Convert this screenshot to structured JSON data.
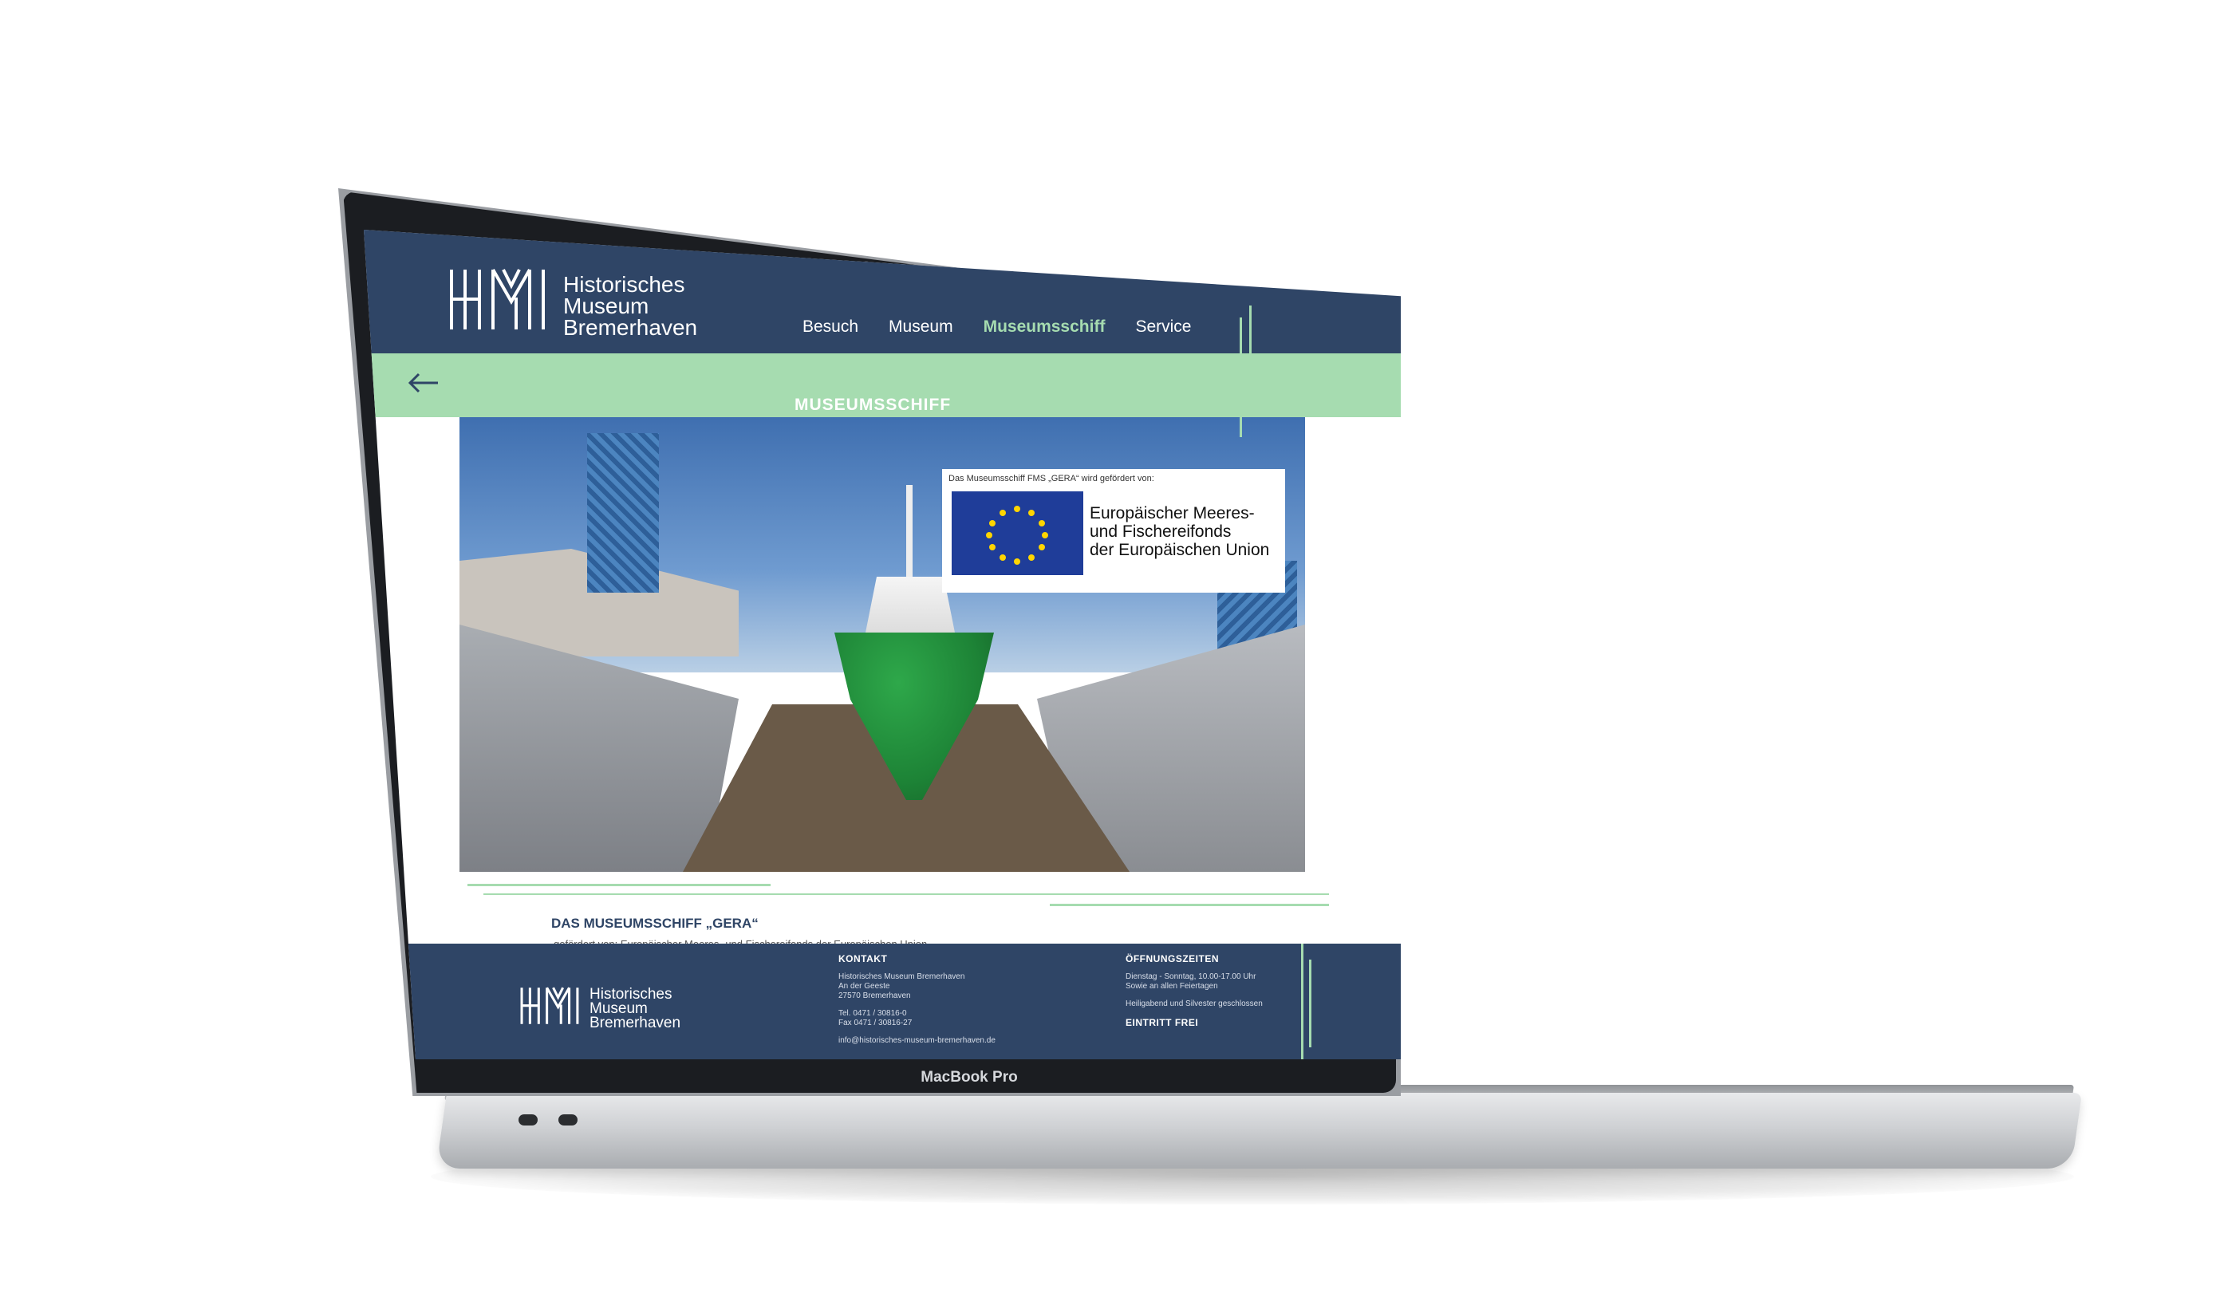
{
  "site": {
    "logo_lines": [
      "Historisches",
      "Museum",
      "Bremerhaven"
    ]
  },
  "nav": {
    "items": [
      "Besuch",
      "Museum",
      "Museumsschiff",
      "Service"
    ],
    "active": "Museumsschiff"
  },
  "page": {
    "heading": "MUSEUMSSCHIFF"
  },
  "hero": {
    "eu_caption": "Das Museumsschiff FMS „GERA“ wird gefördert von:",
    "eu_lines": [
      "Europäischer Meeres-",
      "und Fischereifonds",
      "der Europäischen Union"
    ]
  },
  "article": {
    "title": "DAS MUSEUMSSCHIFF „GERA“",
    "subtitle": "gefördert von: Europäischer Meeres- und Fischereifonds der Europäischen Union"
  },
  "footer": {
    "logo_lines": [
      "Historisches",
      "Museum",
      "Bremerhaven"
    ],
    "kontakt": {
      "heading": "KONTAKT",
      "address": [
        "Historisches Museum Bremerhaven",
        "An der Geeste",
        "27570 Bremerhaven"
      ],
      "tel": "Tel. 0471 / 30816-0",
      "fax": "Fax 0471 / 30816-27",
      "email": "info@historisches-museum-bremerhaven.de"
    },
    "hours": {
      "heading": "ÖFFNUNGSZEITEN",
      "lines": [
        "Dienstag - Sonntag, 10.00-17.00 Uhr",
        "Sowie an allen Feiertagen"
      ],
      "closed": "Heiligabend und Silvester geschlossen",
      "free": "EINTRITT FREI"
    }
  },
  "device": {
    "label": "MacBook Pro"
  },
  "colors": {
    "navy": "#2f4566",
    "mint": "#a6dcb0"
  }
}
